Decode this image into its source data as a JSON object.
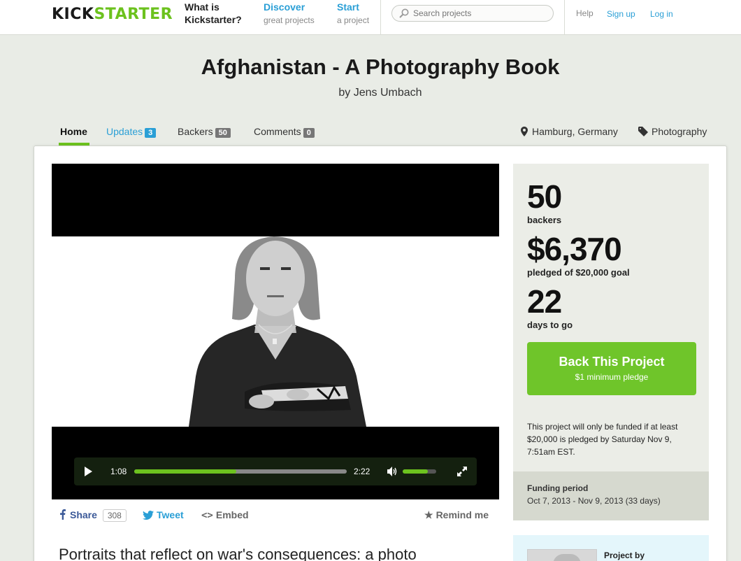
{
  "header": {
    "logo_part1": "KICK",
    "logo_part2": "STARTER",
    "nav": [
      {
        "title_line1": "What is",
        "title_line2": "Kickstarter?",
        "sub": ""
      },
      {
        "title_line1": "Discover",
        "title_line2": "",
        "sub": "great projects"
      },
      {
        "title_line1": "Start",
        "title_line2": "",
        "sub": "a project"
      }
    ],
    "search_placeholder": "Search projects",
    "links": {
      "help": "Help",
      "signup": "Sign up",
      "login": "Log in"
    }
  },
  "project": {
    "title": "Afghanistan - A Photography Book",
    "byline": "by Jens Umbach",
    "location": "Hamburg, Germany",
    "category": "Photography",
    "description_heading": "Portraits that reflect on war's consequences: a photo"
  },
  "tabs": [
    {
      "label": "Home",
      "count": ""
    },
    {
      "label": "Updates",
      "count": "3"
    },
    {
      "label": "Backers",
      "count": "50"
    },
    {
      "label": "Comments",
      "count": "0"
    }
  ],
  "video": {
    "current_time": "1:08",
    "duration": "2:22",
    "progress_fraction": 0.48,
    "volume_fraction": 0.75
  },
  "stats": {
    "backers": "50",
    "backers_label": "backers",
    "pledged": "$6,370",
    "pledged_label": "pledged of $20,000 goal",
    "days": "22",
    "days_label": "days to go",
    "back_button": "Back This Project",
    "back_sub": "$1 minimum pledge",
    "note": "This project will only be funded if at least $20,000 is pledged by Saturday Nov 9, 7:51am EST.",
    "funding_title": "Funding period",
    "funding_dates": "Oct 7, 2013 - Nov 9, 2013 (33 days)",
    "project_by": "Project by"
  },
  "share": {
    "share_label": "Share",
    "share_count": "308",
    "tweet_label": "Tweet",
    "embed_label": "Embed",
    "remind_label": "Remind me"
  },
  "colors": {
    "accent_green": "#6cc21e",
    "link_blue": "#2a9fd6",
    "facebook_blue": "#3b5998"
  }
}
